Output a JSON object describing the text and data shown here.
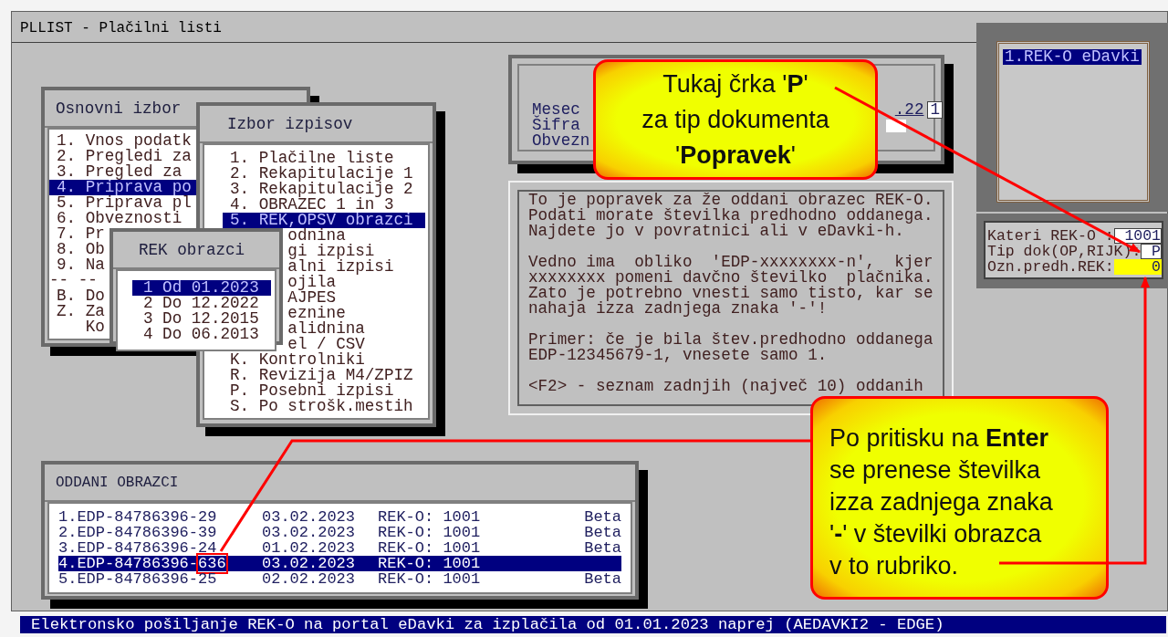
{
  "window": {
    "title": "PLLIST - Plačilni listi"
  },
  "main_menu": {
    "title": "Osnovni izbor",
    "items": [
      {
        "label": "1. Vnos podatk",
        "kind": "item",
        "selected": false
      },
      {
        "label": "2. Pregledi za",
        "kind": "item",
        "selected": false
      },
      {
        "label": "3. Pregled za",
        "kind": "item",
        "selected": false
      },
      {
        "label": "4. Priprava po",
        "kind": "item",
        "selected": true
      },
      {
        "label": "5. Priprava pl",
        "kind": "item",
        "selected": false
      },
      {
        "label": "6. Obveznosti",
        "kind": "item",
        "selected": false
      },
      {
        "label": "7. Pr",
        "kind": "item",
        "selected": false
      },
      {
        "label": "8. Ob",
        "kind": "item",
        "selected": false
      },
      {
        "label": "9. Na",
        "kind": "item",
        "selected": false
      },
      {
        "label": "-- --",
        "kind": "separator",
        "selected": false
      },
      {
        "label": "B. Do",
        "kind": "item",
        "selected": false
      },
      {
        "label": "Z. Za",
        "kind": "item",
        "selected": false
      },
      {
        "label": "Ko",
        "kind": "continuation",
        "selected": false
      }
    ]
  },
  "print_menu": {
    "title": "Izbor izpisov",
    "items": [
      {
        "label": "1. Plačilne liste",
        "kind": "item",
        "selected": false
      },
      {
        "label": "2. Rekapitulacije 1",
        "kind": "item",
        "selected": false
      },
      {
        "label": "3. Rekapitulacije 2",
        "kind": "item",
        "selected": false
      },
      {
        "label": "4. OBRAZEC 1 in 3",
        "kind": "item",
        "selected": false
      },
      {
        "label": "5. REK,OPSV obrazci",
        "kind": "item",
        "selected": true
      },
      {
        "label": "odnina",
        "kind": "clipped",
        "selected": false
      },
      {
        "label": "gi izpisi",
        "kind": "clipped",
        "selected": false
      },
      {
        "label": "alni izpisi",
        "kind": "clipped",
        "selected": false
      },
      {
        "label": "ojila",
        "kind": "clipped",
        "selected": false
      },
      {
        "label": "AJPES",
        "kind": "clipped",
        "selected": false
      },
      {
        "label": "eznine",
        "kind": "clipped",
        "selected": false
      },
      {
        "label": "alidnina",
        "kind": "clipped",
        "selected": false
      },
      {
        "label": "el / CSV",
        "kind": "clipped",
        "selected": false
      },
      {
        "label": "K. Kontrolniki",
        "kind": "item",
        "selected": false
      },
      {
        "label": "R. Revizija M4/ZPIZ",
        "kind": "item",
        "selected": false
      },
      {
        "label": "P. Posebni izpisi",
        "kind": "item",
        "selected": false
      },
      {
        "label": "S. Po strošk.mestih",
        "kind": "item",
        "selected": false
      }
    ]
  },
  "rek_menu": {
    "title": "REK obrazci",
    "items": [
      {
        "label": "1 Od 01.2023",
        "selected": true
      },
      {
        "label": "2 Do 12.2022",
        "selected": false
      },
      {
        "label": "3 Do 12.2015",
        "selected": false
      },
      {
        "label": "4 Do 06.2013",
        "selected": false
      }
    ]
  },
  "period_form": {
    "rows": [
      {
        "label": "Mesec",
        "kind": "values",
        "values": [
          ".22",
          "1"
        ]
      },
      {
        "label": "Šifra",
        "kind": "blank_field"
      },
      {
        "label": "Obvezn",
        "kind": "plain"
      }
    ]
  },
  "help_text": {
    "paragraphs": [
      [
        "To je popravek za že oddani obrazec REK-O.",
        "Podati morate številka predhodno oddanega.",
        "Najdete jo v povratnici ali v eDavki-h."
      ],
      [
        "Vedno ima  obliko  'EDP-xxxxxxxx-n',  kjer",
        "xxxxxxxx pomeni davčno številko  plačnika.",
        "Zato je potrebno vnesti samo tisto, kar se",
        "nahaja izza zadnjega znaka '-'!"
      ],
      [
        "Primer: če je bila štev.predhodno oddanega",
        "EDP-12345679-1, vnesete samo 1."
      ],
      [
        "<F2> - seznam zadnjih (največ 10) oddanih"
      ]
    ]
  },
  "type_list": {
    "items": [
      {
        "label": "1.REK-O eDavki",
        "selected": true
      }
    ]
  },
  "rek_fields": {
    "rows": [
      {
        "label": "Kateri REK-O :",
        "value": "1001",
        "active": false
      },
      {
        "label": "Tip dok(OP,RIJK):",
        "value": "P",
        "active": false
      },
      {
        "label": "Ozn.predh.REK:",
        "value": "0",
        "active": true
      }
    ]
  },
  "submitted": {
    "title": "ODDANI OBRAZCI",
    "rows": [
      {
        "doc": "1.EDP-84786396-",
        "tail": "29",
        "tail_marked": false,
        "date": "03.02.2023",
        "form": "REK-O: 1001",
        "status": "Beta",
        "selected": false
      },
      {
        "doc": "2.EDP-84786396-",
        "tail": "39",
        "tail_marked": false,
        "date": "03.02.2023",
        "form": "REK-O: 1001",
        "status": "Beta",
        "selected": false
      },
      {
        "doc": "3.EDP-84786396-",
        "tail": "24",
        "tail_marked": false,
        "date": "01.02.2023",
        "form": "REK-O: 1001",
        "status": "Beta",
        "selected": false
      },
      {
        "doc": "4.EDP-84786396-",
        "tail": "636",
        "tail_marked": true,
        "date": "03.02.2023",
        "form": "REK-O: 1001",
        "selected": true
      },
      {
        "doc": "5.EDP-84786396-",
        "tail": "25",
        "tail_marked": false,
        "date": "02.02.2023",
        "form": "REK-O: 1001",
        "status": "Beta",
        "selected": false
      }
    ]
  },
  "callouts": [
    {
      "lines": [
        "Tukaj črka '**P**'",
        "za tip dokumenta",
        "'**Popravek**'"
      ]
    },
    {
      "lines": [
        "Po pritisku na **Enter**",
        "se prenese številka",
        "izza zadnjega znaka",
        "'**-**' v številki obrazca",
        "v to rubriko."
      ]
    }
  ],
  "status_bar": "Elektronsko pošiljanje REK-O na portal eDavki za izplačila od 01.01.2023 naprej (AEDAVKI2 - EDGE)"
}
